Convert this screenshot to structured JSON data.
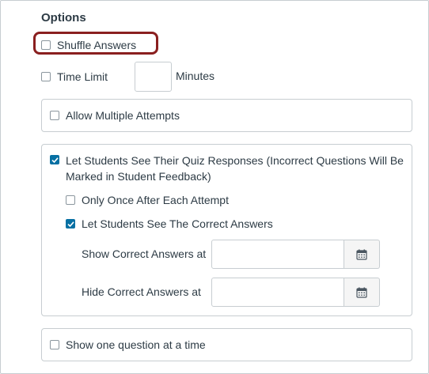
{
  "options": {
    "heading": "Options",
    "shuffle_answers": {
      "label": "Shuffle Answers",
      "checked": false
    },
    "time_limit": {
      "label": "Time Limit",
      "checked": false,
      "value": "",
      "unit": "Minutes"
    },
    "allow_multiple_attempts": {
      "label": "Allow Multiple Attempts",
      "checked": false
    },
    "see_responses": {
      "label_line1": "Let Students See Their Quiz Responses (Incorrect Questions Will Be",
      "label_line2": "Marked in Student Feedback)",
      "checked": true,
      "only_once": {
        "label": "Only Once After Each Attempt",
        "checked": false
      },
      "see_correct": {
        "label": "Let Students See The Correct Answers",
        "checked": true
      },
      "show_correct_at": {
        "label": "Show Correct Answers at",
        "value": ""
      },
      "hide_correct_at": {
        "label": "Hide Correct Answers at",
        "value": ""
      }
    },
    "one_question": {
      "label": "Show one question at a time",
      "checked": false
    }
  },
  "colors": {
    "accent": "#0770a3",
    "highlight": "#8a1f1f",
    "text": "#2d3b45",
    "border": "#c7cdd1"
  },
  "icons": {
    "calendar": "calendar-icon",
    "check": "check-icon"
  }
}
